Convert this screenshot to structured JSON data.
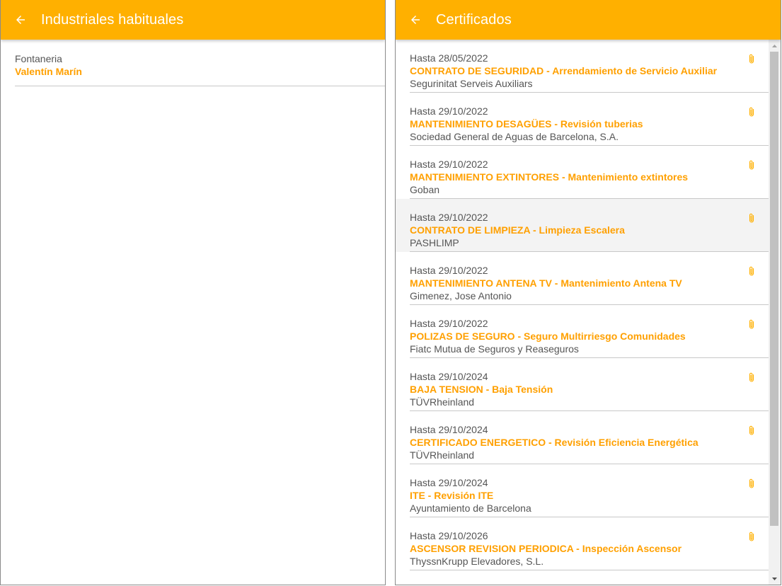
{
  "colors": {
    "accent": "#ffb000",
    "link_text": "#ffa000",
    "secondary_text": "#555555"
  },
  "left_panel": {
    "title": "Industriales habituales",
    "back_icon": "arrow-left-icon",
    "items": [
      {
        "category": "Fontaneria",
        "name": "Valentín Marín"
      }
    ]
  },
  "right_panel": {
    "title": "Certificados",
    "back_icon": "arrow-left-icon",
    "attachment_icon": "paperclip-icon",
    "certificates": [
      {
        "date": "Hasta 28/05/2022",
        "title": "CONTRATO DE SEGURIDAD - Arrendamiento de Servicio Auxiliar",
        "company": "Segurinitat Serveis Auxiliars"
      },
      {
        "date": "Hasta 29/10/2022",
        "title": "MANTENIMIENTO DESAGÜES - Revisión tuberias",
        "company": "Sociedad General de Aguas de Barcelona, S.A."
      },
      {
        "date": "Hasta 29/10/2022",
        "title": "MANTENIMIENTO EXTINTORES - Mantenimiento extintores",
        "company": "Goban"
      },
      {
        "date": "Hasta 29/10/2022",
        "title": "CONTRATO DE LIMPIEZA - Limpieza Escalera",
        "company": "PASHLIMP"
      },
      {
        "date": "Hasta 29/10/2022",
        "title": "MANTENIMIENTO ANTENA TV - Mantenimiento Antena TV",
        "company": "Gimenez, Jose Antonio"
      },
      {
        "date": "Hasta 29/10/2022",
        "title": "POLIZAS DE SEGURO - Seguro Multirriesgo Comunidades",
        "company": "Fiatc Mutua de Seguros y Reaseguros"
      },
      {
        "date": "Hasta 29/10/2024",
        "title": "BAJA TENSION - Baja Tensión",
        "company": "TÜVRheinland"
      },
      {
        "date": "Hasta 29/10/2024",
        "title": "CERTIFICADO ENERGETICO - Revisión Eficiencia Energética",
        "company": "TÜVRheinland"
      },
      {
        "date": "Hasta 29/10/2024",
        "title": "ITE - Revisión ITE",
        "company": "Ayuntamiento de Barcelona"
      },
      {
        "date": "Hasta 29/10/2026",
        "title": "ASCENSOR REVISION PERIODICA - Inspección Ascensor",
        "company": "ThyssnKrupp Elevadores, S.L."
      }
    ]
  }
}
